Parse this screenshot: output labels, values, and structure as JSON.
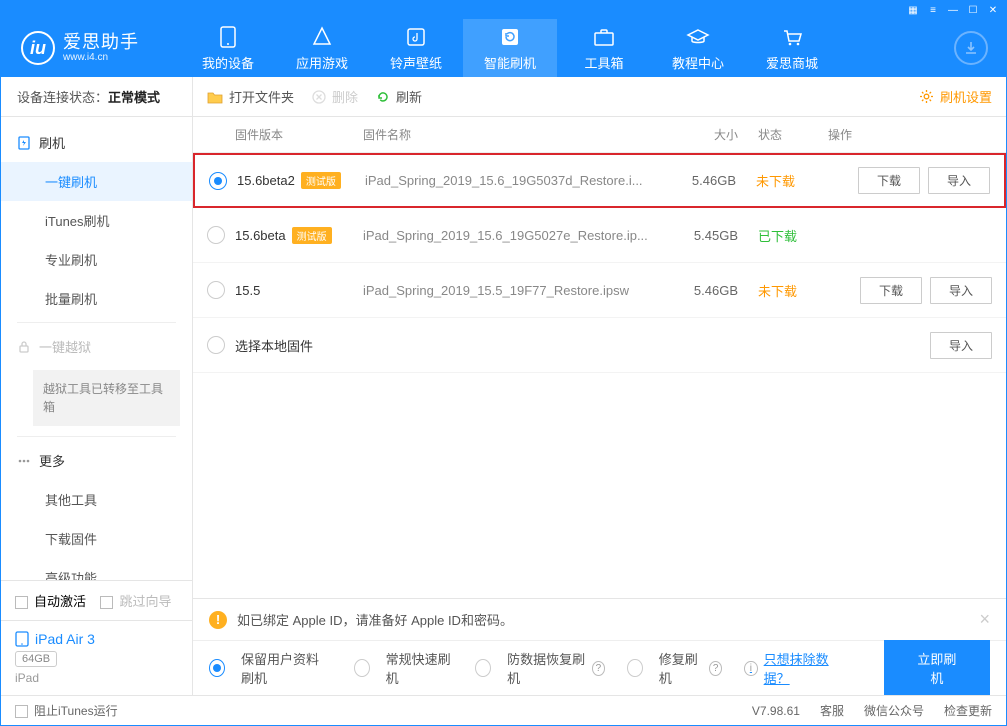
{
  "app": {
    "title": "爱思助手",
    "url": "www.i4.cn"
  },
  "nav": {
    "items": [
      {
        "label": "我的设备"
      },
      {
        "label": "应用游戏"
      },
      {
        "label": "铃声壁纸"
      },
      {
        "label": "智能刷机"
      },
      {
        "label": "工具箱"
      },
      {
        "label": "教程中心"
      },
      {
        "label": "爱思商城"
      }
    ]
  },
  "sidebar": {
    "status_label": "设备连接状态：",
    "status_value": "正常模式",
    "flash": {
      "label": "刷机"
    },
    "flash_items": [
      "一键刷机",
      "iTunes刷机",
      "专业刷机",
      "批量刷机"
    ],
    "jailbreak": {
      "label": "一键越狱",
      "note": "越狱工具已转移至工具箱"
    },
    "more": {
      "label": "更多"
    },
    "more_items": [
      "其他工具",
      "下载固件",
      "高级功能"
    ],
    "auto_activate": "自动激活",
    "skip_guide": "跳过向导",
    "device": {
      "name": "iPad Air 3",
      "storage": "64GB",
      "type": "iPad"
    }
  },
  "toolbar": {
    "open": "打开文件夹",
    "delete": "删除",
    "refresh": "刷新",
    "settings": "刷机设置"
  },
  "table": {
    "headers": {
      "version": "固件版本",
      "name": "固件名称",
      "size": "大小",
      "status": "状态",
      "action": "操作"
    },
    "rows": [
      {
        "version": "15.6beta2",
        "beta": "测试版",
        "name": "iPad_Spring_2019_15.6_19G5037d_Restore.i...",
        "size": "5.46GB",
        "status": "未下载",
        "status_class": "no",
        "download": "下载",
        "import": "导入",
        "selected": true,
        "highlight": true
      },
      {
        "version": "15.6beta",
        "beta": "测试版",
        "name": "iPad_Spring_2019_15.6_19G5027e_Restore.ip...",
        "size": "5.45GB",
        "status": "已下载",
        "status_class": "yes",
        "selected": false
      },
      {
        "version": "15.5",
        "name": "iPad_Spring_2019_15.5_19F77_Restore.ipsw",
        "size": "5.46GB",
        "status": "未下载",
        "status_class": "no",
        "download": "下载",
        "import": "导入",
        "selected": false
      },
      {
        "local": "选择本地固件",
        "import": "导入"
      }
    ]
  },
  "bottom": {
    "warn": "如已绑定 Apple ID，请准备好 Apple ID和密码。",
    "opts": [
      "保留用户资料刷机",
      "常规快速刷机",
      "防数据恢复刷机",
      "修复刷机"
    ],
    "erase": "只想抹除数据？",
    "flash_btn": "立即刷机"
  },
  "footer": {
    "block_itunes": "阻止iTunes运行",
    "version": "V7.98.61",
    "service": "客服",
    "wechat": "微信公众号",
    "update": "检查更新"
  }
}
